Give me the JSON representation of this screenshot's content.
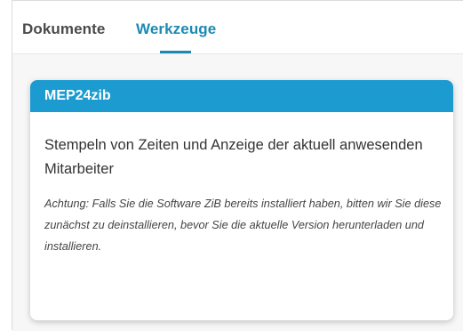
{
  "tabs": [
    {
      "label": "Dokumente",
      "active": false
    },
    {
      "label": "Werkzeuge",
      "active": true
    }
  ],
  "colors": {
    "accent": "#1a8ab3",
    "card_header": "#1b9bd0"
  },
  "card": {
    "title": "MEP24zib",
    "subtitle": "Stempeln von Zeiten und Anzeige der aktuell anwesenden Mitarbeiter",
    "note": "Achtung: Falls Sie die Software ZiB bereits installiert haben, bitten wir Sie diese zunächst zu deinstallieren, bevor Sie die aktuelle Version herunterladen und installieren."
  }
}
